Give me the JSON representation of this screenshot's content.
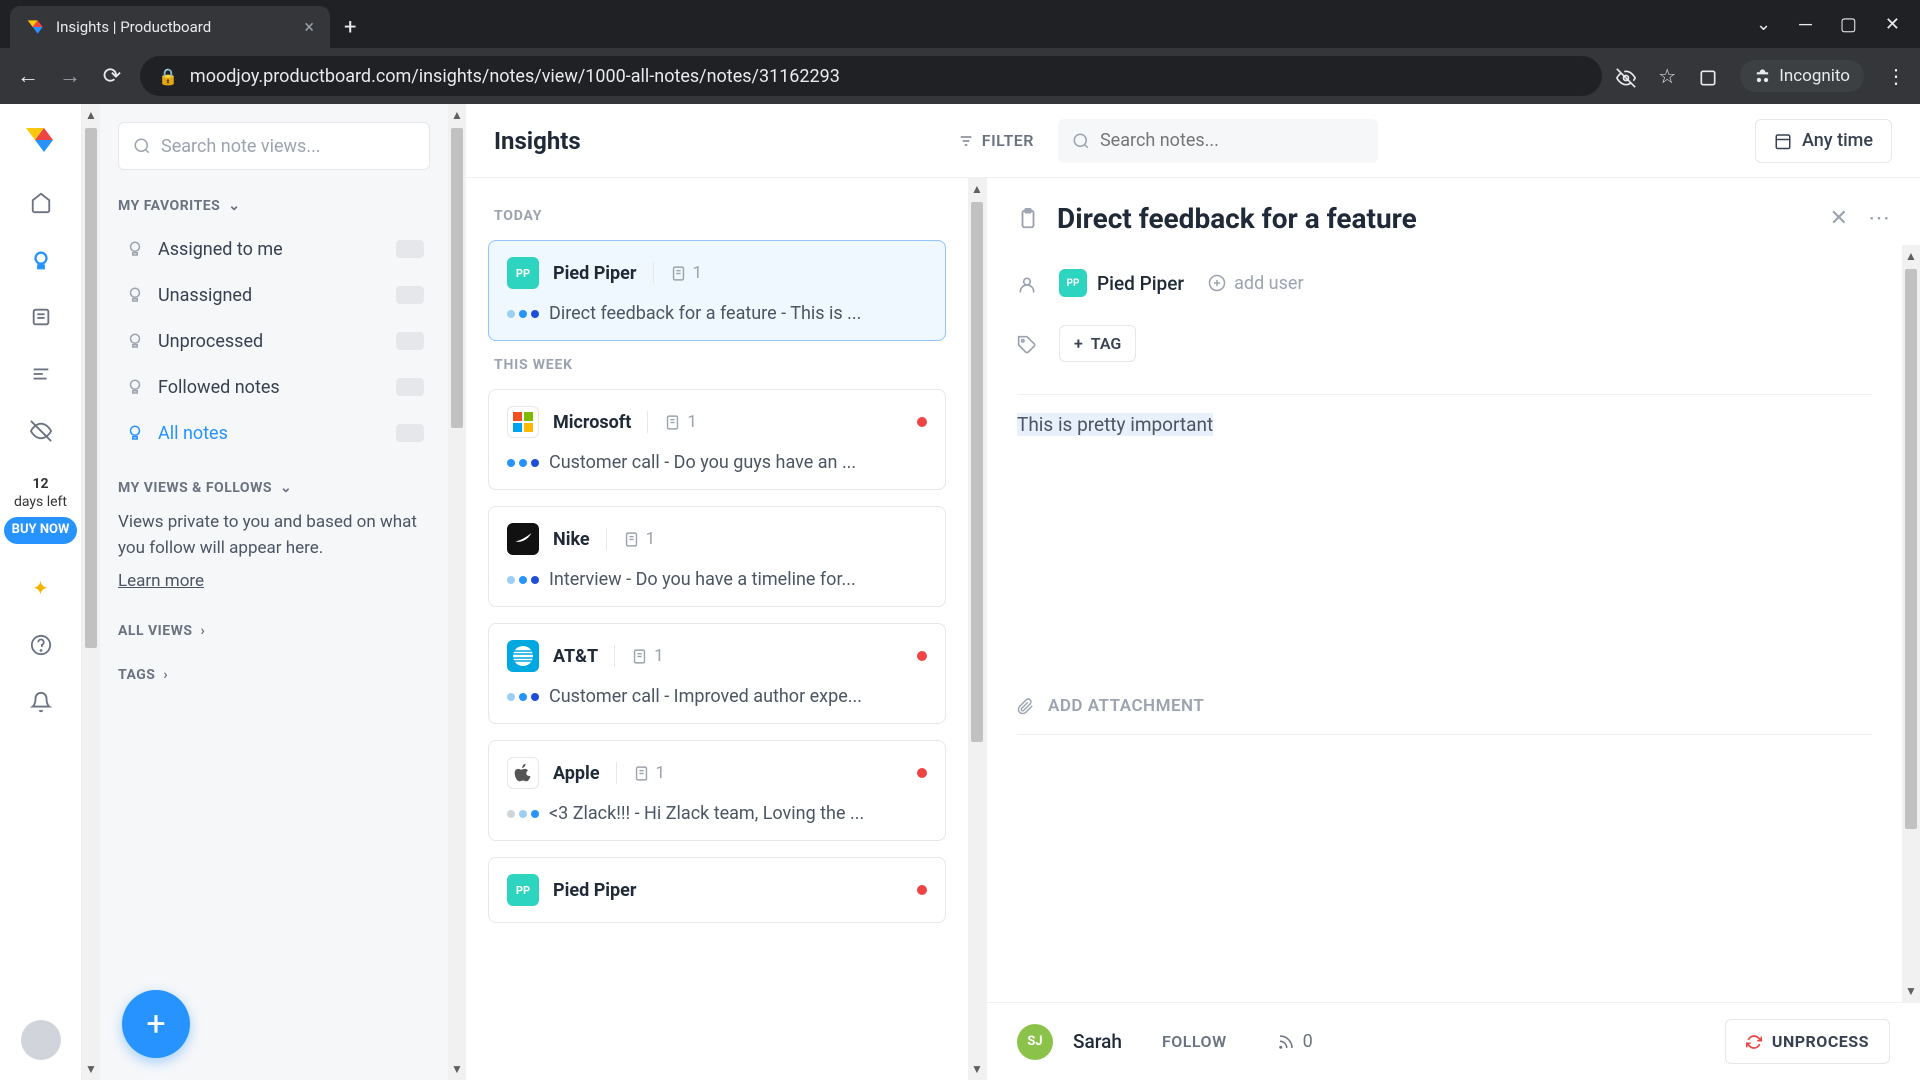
{
  "browser": {
    "tab_title": "Insights | Productboard",
    "url": "moodjoy.productboard.com/insights/notes/view/1000-all-notes/notes/31162293",
    "incognito_label": "Incognito"
  },
  "rail": {
    "trial_days": "12",
    "trial_label": "days left",
    "buy_now": "BUY NOW"
  },
  "sidebar": {
    "search_placeholder": "Search note views...",
    "favorites_header": "MY FAVORITES",
    "favorites": [
      {
        "label": "Assigned to me"
      },
      {
        "label": "Unassigned"
      },
      {
        "label": "Unprocessed"
      },
      {
        "label": "Followed notes"
      },
      {
        "label": "All notes"
      }
    ],
    "views_header": "MY VIEWS & FOLLOWS",
    "views_desc": "Views private to you and based on what you follow will appear here.",
    "learn_more": "Learn more",
    "all_views_header": "ALL VIEWS",
    "tags_header": "TAGS"
  },
  "header": {
    "title": "Insights",
    "filter_label": "FILTER",
    "search_placeholder": "Search notes...",
    "anytime_label": "Any time"
  },
  "notes": {
    "groups": [
      {
        "label": "TODAY",
        "items": [
          {
            "company": "Pied Piper",
            "logo_bg": "#2dd4bf",
            "logo_text": "PP",
            "count": "1",
            "selected": true,
            "status": null,
            "dots": [
              "#9ccff3",
              "#2693ff",
              "#1d4ed8"
            ],
            "snippet": "Direct feedback for a feature - This is ..."
          }
        ]
      },
      {
        "label": "THIS WEEK",
        "items": [
          {
            "company": "Microsoft",
            "logo_bg": "#ffffff",
            "logo_text": "",
            "logo_kind": "microsoft",
            "count": "1",
            "status": "#ef4444",
            "dots": [
              "#2693ff",
              "#2693ff",
              "#1d4ed8"
            ],
            "snippet": "Customer call - Do you guys have an ..."
          },
          {
            "company": "Nike",
            "logo_bg": "#111111",
            "logo_text": "",
            "logo_kind": "nike",
            "count": "1",
            "status": null,
            "dots": [
              "#9ccff3",
              "#2693ff",
              "#1d4ed8"
            ],
            "snippet": "Interview - Do you have a timeline for..."
          },
          {
            "company": "AT&T",
            "logo_bg": "#00a8e0",
            "logo_text": "",
            "logo_kind": "att",
            "count": "1",
            "status": "#ef4444",
            "dots": [
              "#9ccff3",
              "#2693ff",
              "#1d4ed8"
            ],
            "snippet": "Customer call - Improved author expe..."
          },
          {
            "company": "Apple",
            "logo_bg": "#ffffff",
            "logo_text": "",
            "logo_kind": "apple",
            "count": "1",
            "status": "#ef4444",
            "dots": [
              "#d1d5db",
              "#9ccff3",
              "#2693ff"
            ],
            "snippet": "<3 Zlack!!! - Hi Zlack team, Loving the ..."
          },
          {
            "company": "Pied Piper",
            "logo_bg": "#2dd4bf",
            "logo_text": "PP",
            "count": "",
            "status": "#ef4444",
            "dots": [],
            "snippet": ""
          }
        ]
      }
    ]
  },
  "detail": {
    "title": "Direct feedback for a feature",
    "company": "Pied Piper",
    "company_logo_bg": "#2dd4bf",
    "company_logo_text": "PP",
    "add_user_label": "add user",
    "tag_label": "TAG",
    "content": "This is pretty important",
    "attach_label": "ADD ATTACHMENT",
    "owner_initials": "SJ",
    "owner_name": "Sarah",
    "follow_label": "FOLLOW",
    "followers_count": "0",
    "unprocess_label": "UNPROCESS"
  }
}
